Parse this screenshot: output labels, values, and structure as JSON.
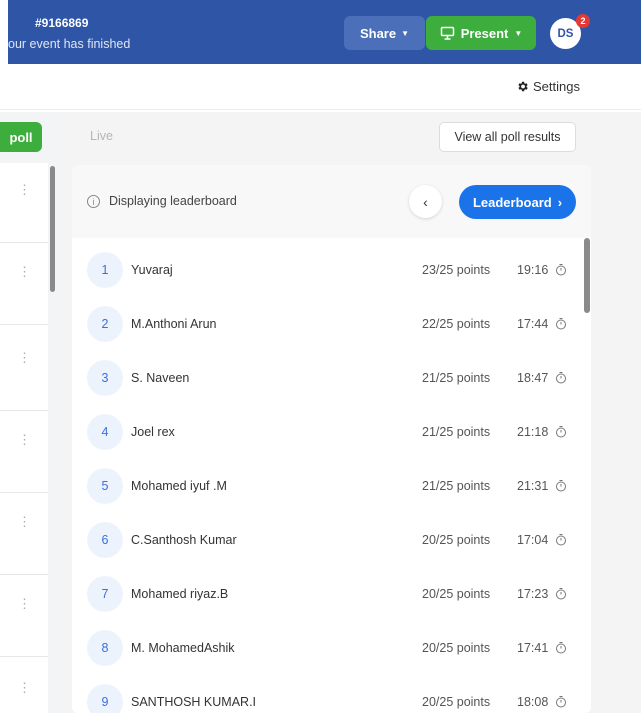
{
  "header": {
    "event_id": "#9166869",
    "event_status": "our event has finished",
    "share_label": "Share",
    "present_label": "Present",
    "avatar_initials": "DS",
    "notification_count": "2",
    "colors": {
      "topbar": "#2f55a6",
      "present": "#3dae3d",
      "accent": "#1a73e8"
    }
  },
  "settings_label": "Settings",
  "left_panel": {
    "poll_button": "poll",
    "kebab_glyph": "⋮"
  },
  "main": {
    "live_label": "Live",
    "view_all_label": "View all poll results",
    "displaying_label": "Displaying leaderboard",
    "back_glyph": "‹",
    "leaderboard_label": "Leaderboard",
    "leaderboard_chevron": "›"
  },
  "leaderboard": [
    {
      "rank": "1",
      "name": "Yuvaraj",
      "points": "23/25 points",
      "time": "19:16"
    },
    {
      "rank": "2",
      "name": "M.Anthoni Arun",
      "points": "22/25 points",
      "time": "17:44"
    },
    {
      "rank": "3",
      "name": "S. Naveen",
      "points": "21/25 points",
      "time": "18:47"
    },
    {
      "rank": "4",
      "name": "Joel rex",
      "points": "21/25 points",
      "time": "21:18"
    },
    {
      "rank": "5",
      "name": "Mohamed iyuf .M",
      "points": "21/25 points",
      "time": "21:31"
    },
    {
      "rank": "6",
      "name": "C.Santhosh Kumar",
      "points": "20/25 points",
      "time": "17:04"
    },
    {
      "rank": "7",
      "name": "Mohamed riyaz.B",
      "points": "20/25 points",
      "time": "17:23"
    },
    {
      "rank": "8",
      "name": "M. MohamedAshik",
      "points": "20/25 points",
      "time": "17:41"
    },
    {
      "rank": "9",
      "name": "SANTHOSH KUMAR.I",
      "points": "20/25 points",
      "time": "18:08"
    }
  ]
}
